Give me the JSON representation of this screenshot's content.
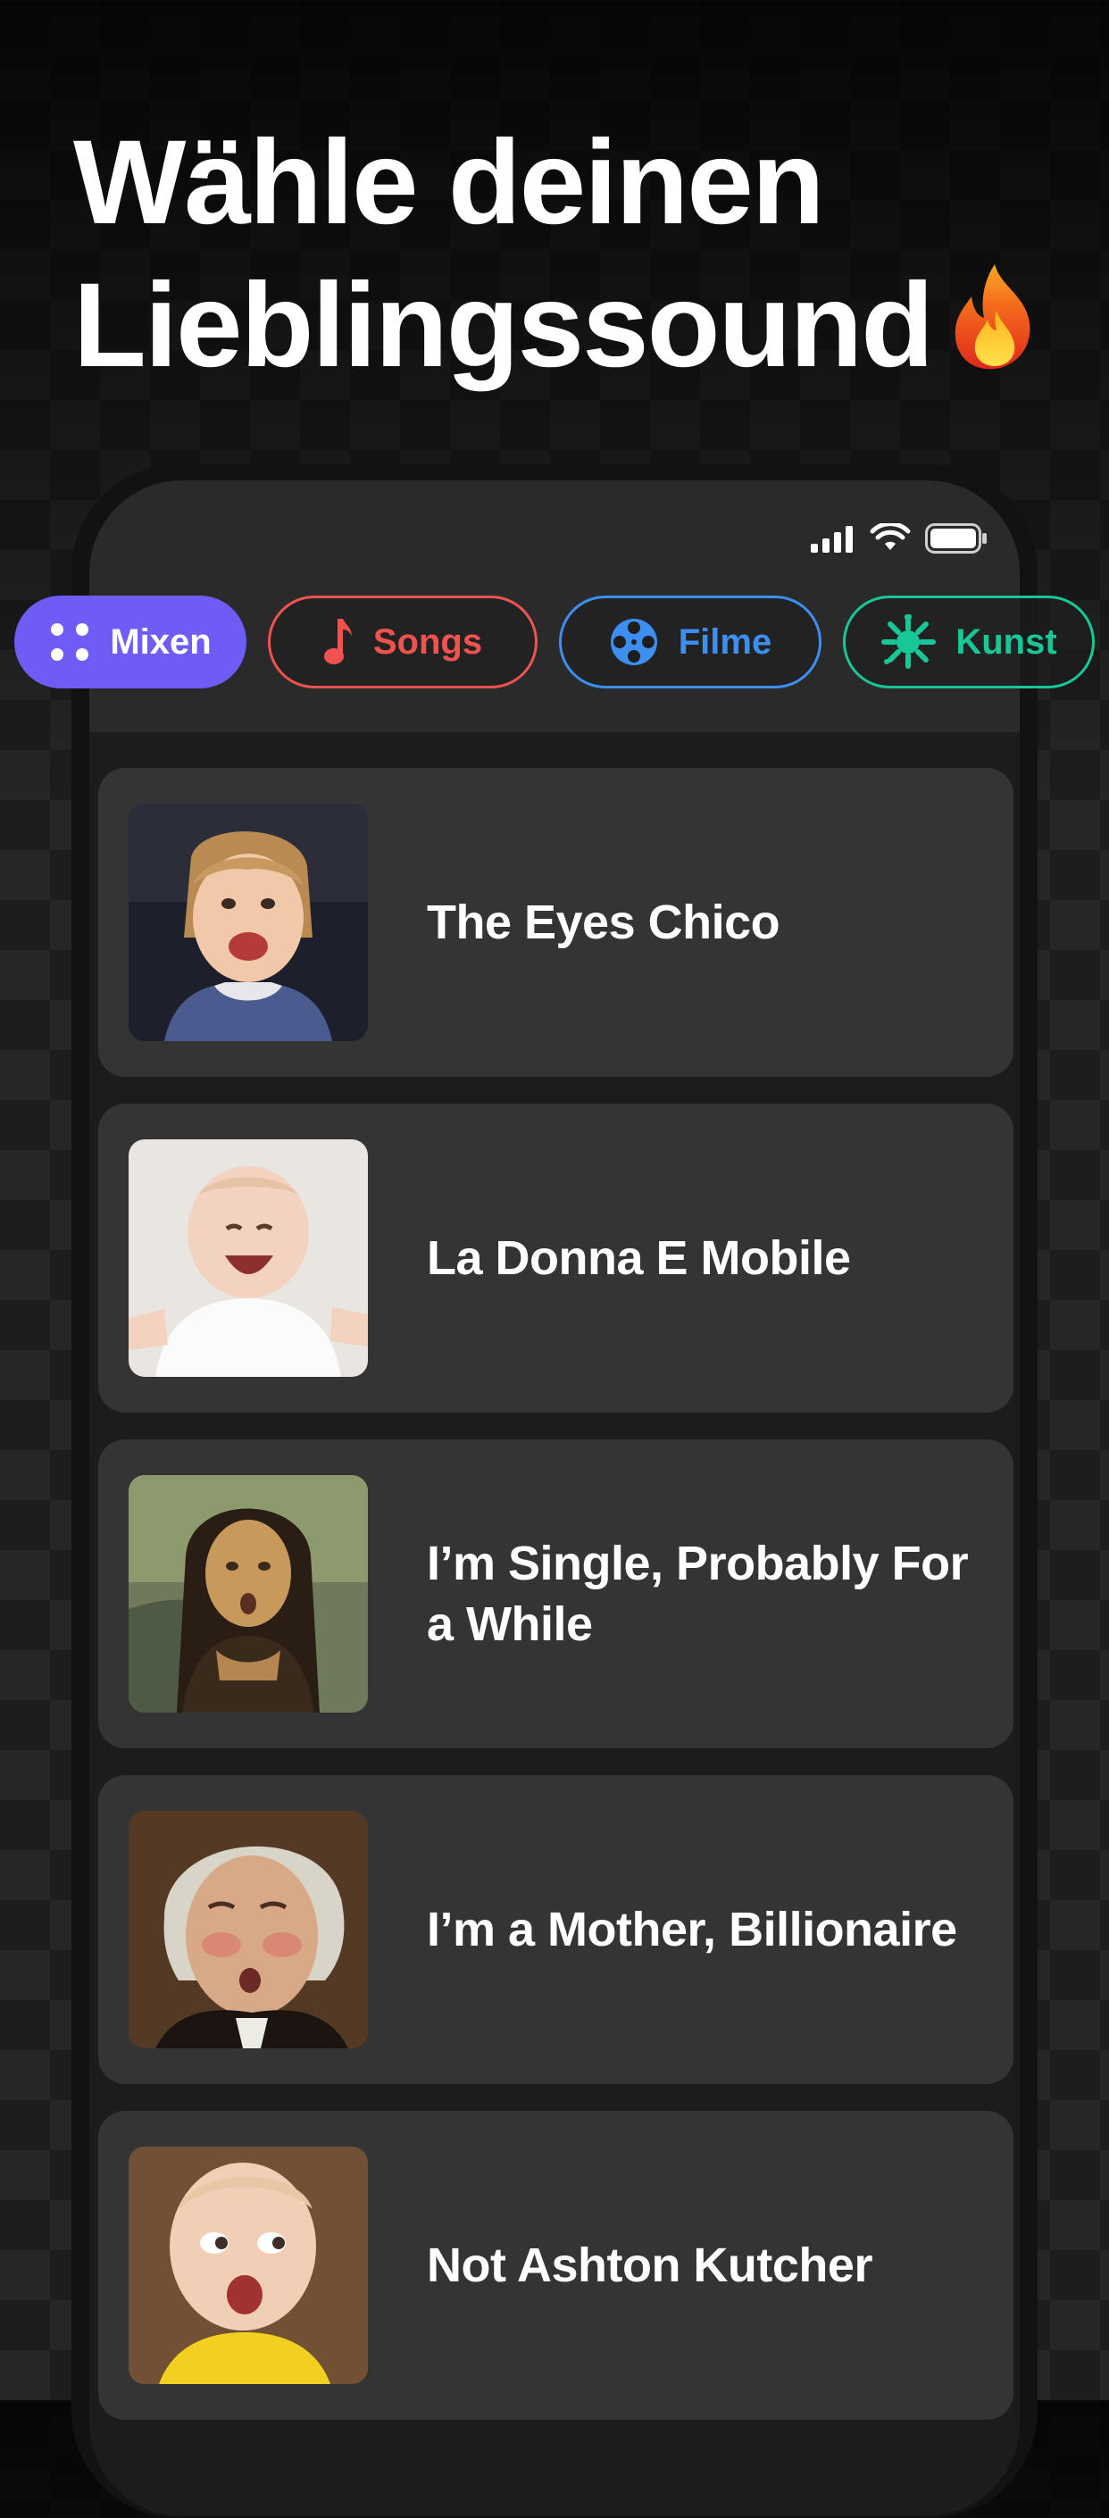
{
  "headline": {
    "line1": "Wähle deinen",
    "line2": "Lieblingssound",
    "emoji_icon": "fire-icon"
  },
  "status_bar": {
    "icons": [
      "cellular-signal-icon",
      "wifi-icon",
      "battery-icon"
    ]
  },
  "categories": [
    {
      "label": "Mixen",
      "icon": "grid-dots-icon",
      "color": "#6f5cf7",
      "selected": true
    },
    {
      "label": "Songs",
      "icon": "music-note-icon",
      "color": "#f0534f",
      "selected": false
    },
    {
      "label": "Filme",
      "icon": "film-reel-icon",
      "color": "#3c8ff1",
      "selected": false
    },
    {
      "label": "Kunst",
      "icon": "paint-splash-icon",
      "color": "#18c697",
      "selected": false
    }
  ],
  "sounds": [
    {
      "title": "The Eyes Chico",
      "thumbnail": "smiling-toddler-photo"
    },
    {
      "title": "La Donna E Mobile",
      "thumbnail": "laughing-baby-photo"
    },
    {
      "title": "I’m Single, Probably For a While",
      "thumbnail": "mona-lisa-painting"
    },
    {
      "title": "I’m a Mother, Billionaire",
      "thumbnail": "george-washington-portrait"
    },
    {
      "title": "Not Ashton Kutcher",
      "thumbnail": "surprised-baby-photo"
    }
  ],
  "colors": {
    "background": "#1d1d1d",
    "card": "#343434",
    "header_panel": "#2a2a2a",
    "accent_mixen": "#6f5cf7",
    "accent_songs": "#f0534f",
    "accent_filme": "#3c8ff1",
    "accent_kunst": "#18c697"
  }
}
